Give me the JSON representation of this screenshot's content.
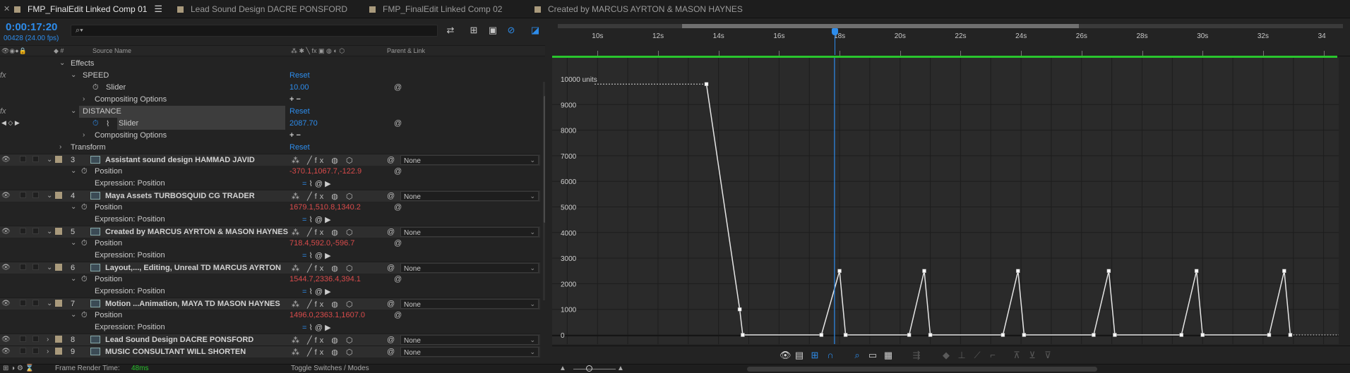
{
  "tabs": [
    {
      "label": "FMP_FinalEdit Linked Comp 01",
      "active": true
    },
    {
      "label": "Lead Sound Design DACRE PONSFORD",
      "active": false
    },
    {
      "label": "FMP_FinalEdit Linked Comp 02",
      "active": false
    },
    {
      "label": "Created by MARCUS AYRTON & MASON HAYNES",
      "active": false
    }
  ],
  "timeline": {
    "timecode": "0:00:17:20",
    "frames": "00428 (24.00 fps)"
  },
  "columns": {
    "source_name": "Source Name",
    "parent_link": "Parent & Link"
  },
  "effects": {
    "effects_label": "Effects",
    "speed_label": "SPEED",
    "speed_reset": "Reset",
    "speed_slider_label": "Slider",
    "speed_slider_value": "10.00",
    "compositing_label": "Compositing Options",
    "distance_label": "DISTANCE",
    "distance_reset": "Reset",
    "distance_slider_label": "Slider",
    "distance_slider_value": "2087.70",
    "compositing_label_2": "Compositing Options",
    "transform_label": "Transform",
    "transform_reset": "Reset"
  },
  "layers": [
    {
      "num": "3",
      "name": "Assistant sound design HAMMAD JAVID",
      "position": "-370.1,1067.7,-122.9",
      "parent": "None"
    },
    {
      "num": "4",
      "name": "Maya Assets TURBOSQUID CG TRADER",
      "position": "1679.1,510.8,1340.2",
      "parent": "None"
    },
    {
      "num": "5",
      "name": "Created by MARCUS AYRTON & MASON HAYNES",
      "position": "718.4,592.0,-596.7",
      "parent": "None"
    },
    {
      "num": "6",
      "name": "Layout,..., Editing, Unreal TD MARCUS AYRTON",
      "position": "1544.7,2336.4,394.1",
      "parent": "None"
    },
    {
      "num": "7",
      "name": "Motion ...Animation, MAYA TD MASON HAYNES",
      "position": "1496.0,2363.1,1607.0",
      "parent": "None"
    },
    {
      "num": "8",
      "name": "Lead Sound Design DACRE PONSFORD",
      "parent": "None"
    },
    {
      "num": "9",
      "name": "MUSIC CONSULTANT WILL SHORTEN",
      "parent": "None"
    }
  ],
  "labels": {
    "position": "Position",
    "expression_position": "Expression: Position"
  },
  "graph": {
    "units_label": "10000 units",
    "y_ticks": [
      "9000",
      "8000",
      "7000",
      "6000",
      "5000",
      "4000",
      "3000",
      "2000",
      "1000",
      "0"
    ],
    "x_ticks": [
      "10s",
      "12s",
      "14s",
      "16s",
      "18s",
      "20s",
      "22s",
      "24s",
      "26s",
      "28s",
      "30s",
      "32s",
      "34"
    ],
    "playhead_time": "17:20"
  },
  "status": {
    "render_label": "Frame Render Time:",
    "render_value": "48ms",
    "toggle_label": "Toggle Switches / Modes"
  },
  "chart_data": {
    "type": "line",
    "title": "",
    "xlabel": "",
    "ylabel": "",
    "series": [
      {
        "x": [
          13.6,
          14.7,
          14.8,
          17.4,
          18.0,
          18.2,
          20.3,
          20.8,
          21.0,
          23.4,
          23.9,
          24.1,
          26.4,
          26.9,
          27.1,
          29.3,
          29.8,
          30.0,
          32.2,
          32.7,
          32.9
        ],
        "values": [
          9800,
          1000,
          0,
          0,
          2500,
          0,
          0,
          2500,
          0,
          0,
          2500,
          0,
          0,
          2500,
          0,
          0,
          2500,
          0,
          0,
          2500,
          0
        ]
      }
    ],
    "xlim": [
      8.5,
      34.5
    ],
    "ylim": [
      0,
      10000
    ],
    "grid": true
  }
}
